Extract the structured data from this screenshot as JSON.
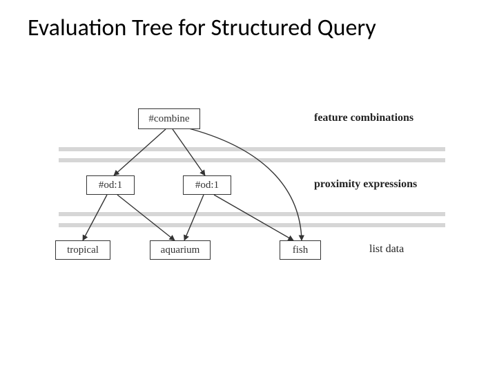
{
  "title": "Evaluation Tree for Structured Query",
  "nodes": {
    "combine": "#combine",
    "od1a": "#od:1",
    "od1b": "#od:1",
    "tropical": "tropical",
    "aquarium": "aquarium",
    "fish": "fish"
  },
  "row_labels": {
    "level1": "feature combinations",
    "level2": "proximity expressions",
    "level3": "list data"
  },
  "chart_data": {
    "type": "tree",
    "title": "Evaluation Tree for Structured Query",
    "levels": [
      {
        "label": "feature combinations",
        "nodes": [
          "#combine"
        ]
      },
      {
        "label": "proximity expressions",
        "nodes": [
          "#od:1",
          "#od:1"
        ]
      },
      {
        "label": "list data",
        "nodes": [
          "tropical",
          "aquarium",
          "fish"
        ]
      }
    ],
    "edges": [
      {
        "from": "#combine",
        "to": "#od:1 (left)"
      },
      {
        "from": "#combine",
        "to": "#od:1 (right)"
      },
      {
        "from": "#combine",
        "to": "fish"
      },
      {
        "from": "#od:1 (left)",
        "to": "tropical"
      },
      {
        "from": "#od:1 (left)",
        "to": "aquarium"
      },
      {
        "from": "#od:1 (right)",
        "to": "aquarium"
      },
      {
        "from": "#od:1 (right)",
        "to": "fish"
      }
    ]
  }
}
